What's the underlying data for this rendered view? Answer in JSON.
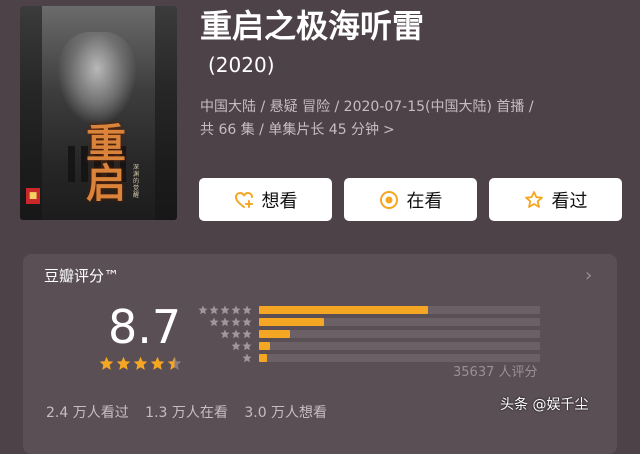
{
  "poster": {
    "art_text": "重启",
    "tagline": "深渊的觉醒"
  },
  "title": "重启之极海听雷",
  "year": "(2020)",
  "meta": {
    "line1": "中国大陆 / 悬疑 冒险 / 2020-07-15(中国大陆) 首播 /",
    "line2": "共 66 集 / 单集片长 45 分钟",
    "chevron": ">"
  },
  "buttons": [
    {
      "label": "想看",
      "icon": "heart-plus-icon"
    },
    {
      "label": "在看",
      "icon": "eye-circle-icon"
    },
    {
      "label": "看过",
      "icon": "star-outline-icon"
    }
  ],
  "rating": {
    "title": "豆瓣评分™",
    "chevron": "›",
    "score": "8.7",
    "score_stars": 4.5,
    "distribution": [
      {
        "stars": 5,
        "fraction": 0.6
      },
      {
        "stars": 4,
        "fraction": 0.23
      },
      {
        "stars": 3,
        "fraction": 0.11
      },
      {
        "stars": 2,
        "fraction": 0.04
      },
      {
        "stars": 1,
        "fraction": 0.03
      }
    ],
    "count_text": "35637 人评分"
  },
  "stats": {
    "watched": "2.4 万人看过",
    "watching": "1.3 万人在看",
    "want": "3.0 万人想看"
  },
  "watermark": "头条 @娱千尘",
  "colors": {
    "background": "#4e4249",
    "panel": "#5b4f56",
    "accent": "#f5a623",
    "muted": "#c8bcc3"
  }
}
